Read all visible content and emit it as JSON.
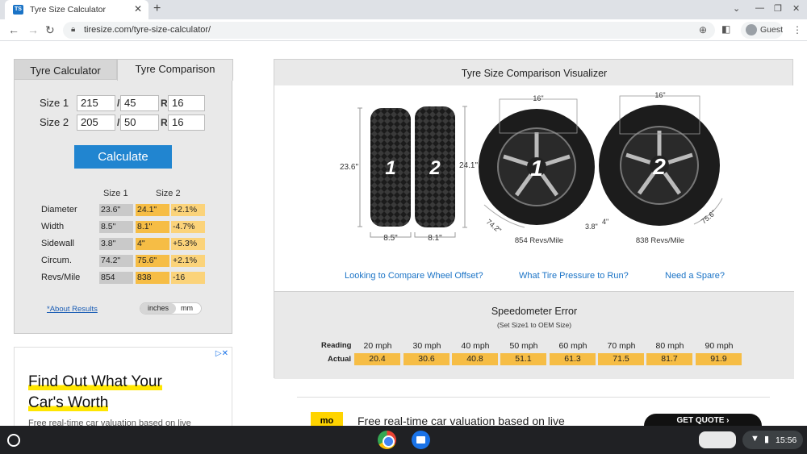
{
  "browser": {
    "tab_title": "Tyre Size Calculator",
    "favicon_text": "TS",
    "url": "tiresize.com/tyre-size-calculator/",
    "profile": "Guest"
  },
  "calculator": {
    "tabs": [
      "Tyre Calculator",
      "Tyre Comparison"
    ],
    "size1": {
      "label": "Size 1",
      "width": "215",
      "aspect": "45",
      "rim": "16"
    },
    "size2": {
      "label": "Size 2",
      "width": "205",
      "aspect": "50",
      "rim": "16"
    },
    "sep_slash": "/",
    "sep_r": "R",
    "calculate_label": "Calculate",
    "col_size1": "Size 1",
    "col_size2": "Size 2",
    "rows": [
      {
        "label": "Diameter",
        "s1": "23.6\"",
        "s2": "24.1\"",
        "diff": "+2.1%"
      },
      {
        "label": "Width",
        "s1": "8.5\"",
        "s2": "8.1\"",
        "diff": "-4.7%"
      },
      {
        "label": "Sidewall",
        "s1": "3.8\"",
        "s2": "4\"",
        "diff": "+5.3%"
      },
      {
        "label": "Circum.",
        "s1": "74.2\"",
        "s2": "75.6\"",
        "diff": "+2.1%"
      },
      {
        "label": "Revs/Mile",
        "s1": "854",
        "s2": "838",
        "diff": "-16"
      }
    ],
    "about_link": "*About Results",
    "unit_inches": "inches",
    "unit_mm": "mm"
  },
  "ad_left": {
    "headline_1": "Find Out What Your",
    "headline_2": "Car's Worth",
    "sub": "Free real-time car valuation based on live"
  },
  "visualizer": {
    "title": "Tyre Size Comparison Visualizer",
    "tread_labels": {
      "d1": "23.6\"",
      "d2": "24.1\"",
      "w1": "8.5\"",
      "w2": "8.1\"",
      "n1": "1",
      "n2": "2"
    },
    "wheel1": {
      "rim": "16\"",
      "circ": "74.2\"",
      "sidewall": "3.8\"",
      "revs": "854 Revs/Mile",
      "num": "1"
    },
    "wheel2": {
      "rim": "16\"",
      "circ": "75.6\"",
      "sidewall": "4\"",
      "revs": "838 Revs/Mile",
      "num": "2"
    },
    "links": [
      "Looking to Compare Wheel Offset?",
      "What Tire Pressure to Run?",
      "Need a Spare?"
    ]
  },
  "speedometer": {
    "title": "Speedometer Error",
    "subtitle": "(Set Size1 to OEM Size)",
    "reading_label": "Reading",
    "actual_label": "Actual",
    "readings": [
      "20 mph",
      "30 mph",
      "40 mph",
      "50 mph",
      "60 mph",
      "70 mph",
      "80 mph",
      "90 mph"
    ],
    "actual": [
      "20.4",
      "30.6",
      "40.8",
      "51.1",
      "61.3",
      "71.5",
      "81.7",
      "91.9"
    ]
  },
  "ad_bottom": {
    "text": "Free real-time car valuation based on live",
    "logo": "mo",
    "cta": "GET QUOTE ›"
  },
  "taskbar": {
    "time": "15:56"
  }
}
